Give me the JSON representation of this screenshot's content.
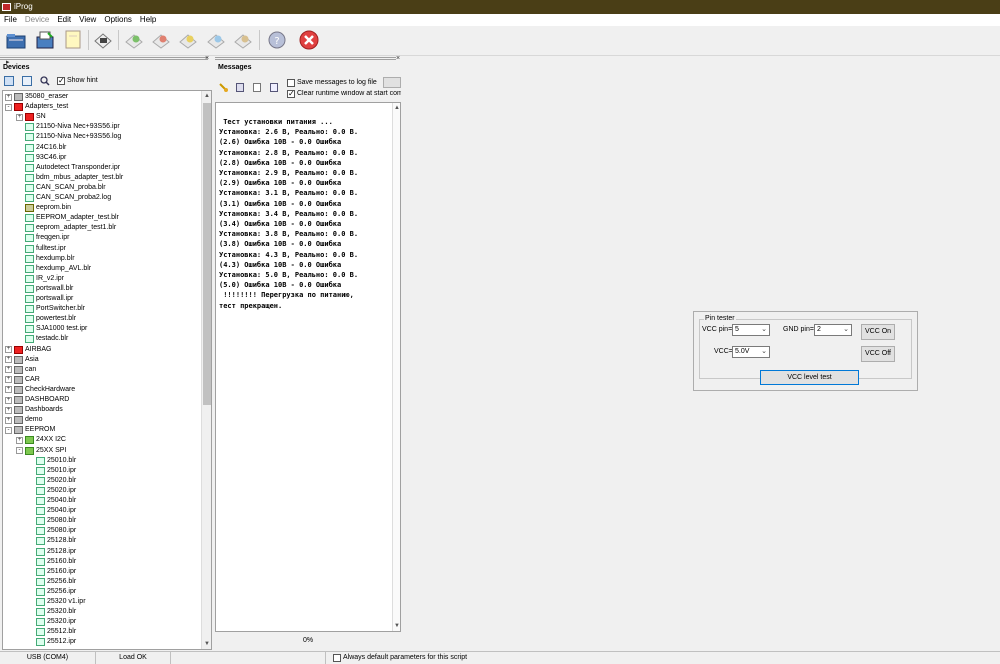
{
  "app": {
    "title": "iProg"
  },
  "menu": [
    {
      "label": "File",
      "disabled": false
    },
    {
      "label": "Device",
      "disabled": true
    },
    {
      "label": "Edit",
      "disabled": false
    },
    {
      "label": "View",
      "disabled": false
    },
    {
      "label": "Options",
      "disabled": false
    },
    {
      "label": "Help",
      "disabled": false
    }
  ],
  "devices": {
    "title": "Devices",
    "show_hint_label": "Show hint",
    "show_hint_checked": true,
    "tree": [
      {
        "label": "35080_eraser",
        "type": "tool",
        "level": 0,
        "expander": "+"
      },
      {
        "label": "Adapters_test",
        "type": "folder-red",
        "level": 0,
        "expander": "-"
      },
      {
        "label": "SN",
        "type": "folder-red",
        "level": 1,
        "expander": "+"
      },
      {
        "label": "21150-Niva Nec+93S56.ipr",
        "type": "file",
        "level": 1
      },
      {
        "label": "21150-Niva Nec+93S56.log",
        "type": "file",
        "level": 1
      },
      {
        "label": "24C16.blr",
        "type": "file",
        "level": 1
      },
      {
        "label": "93C46.ipr",
        "type": "file",
        "level": 1
      },
      {
        "label": "Autodetect Transponder.ipr",
        "type": "file",
        "level": 1
      },
      {
        "label": "bdm_mbus_adapter_test.blr",
        "type": "file",
        "level": 1
      },
      {
        "label": "CAN_SCAN_proba.blr",
        "type": "file",
        "level": 1
      },
      {
        "label": "CAN_SCAN_proba2.log",
        "type": "file",
        "level": 1
      },
      {
        "label": "eeprom.bin",
        "type": "bin",
        "level": 1
      },
      {
        "label": "EEPROM_adapter_test.blr",
        "type": "file",
        "level": 1
      },
      {
        "label": "eeprom_adapter_test1.blr",
        "type": "file",
        "level": 1
      },
      {
        "label": "freqgen.ipr",
        "type": "file",
        "level": 1
      },
      {
        "label": "fulltest.ipr",
        "type": "file",
        "level": 1
      },
      {
        "label": "hexdump.blr",
        "type": "file",
        "level": 1
      },
      {
        "label": "hexdump_AVL.blr",
        "type": "file",
        "level": 1
      },
      {
        "label": "IR_v2.ipr",
        "type": "file",
        "level": 1
      },
      {
        "label": "portswall.blr",
        "type": "file",
        "level": 1
      },
      {
        "label": "portswall.ipr",
        "type": "file",
        "level": 1
      },
      {
        "label": "PortSwitcher.blr",
        "type": "file",
        "level": 1
      },
      {
        "label": "powertest.blr",
        "type": "file",
        "level": 1
      },
      {
        "label": "SJA1000 test.ipr",
        "type": "file",
        "level": 1
      },
      {
        "label": "testadc.blr",
        "type": "file",
        "level": 1
      },
      {
        "label": "AIRBAG",
        "type": "red",
        "level": 0,
        "expander": "+"
      },
      {
        "label": "Asia",
        "type": "gray",
        "level": 0,
        "expander": "+"
      },
      {
        "label": "can",
        "type": "gray",
        "level": 0,
        "expander": "+"
      },
      {
        "label": "CAR",
        "type": "gray",
        "level": 0,
        "expander": "+"
      },
      {
        "label": "CheckHardware",
        "type": "gray",
        "level": 0,
        "expander": "+"
      },
      {
        "label": "DASHBOARD",
        "type": "gray",
        "level": 0,
        "expander": "+"
      },
      {
        "label": "Dashboards",
        "type": "gray",
        "level": 0,
        "expander": "+"
      },
      {
        "label": "demo",
        "type": "gray",
        "level": 0,
        "expander": "+"
      },
      {
        "label": "EEPROM",
        "type": "gray",
        "level": 0,
        "expander": "-"
      },
      {
        "label": "24XX I2C",
        "type": "folder",
        "level": 1,
        "expander": "+"
      },
      {
        "label": "25XX SPI",
        "type": "folder",
        "level": 1,
        "expander": "-"
      },
      {
        "label": "25010.blr",
        "type": "file",
        "level": 2
      },
      {
        "label": "25010.ipr",
        "type": "file",
        "level": 2
      },
      {
        "label": "25020.blr",
        "type": "file",
        "level": 2
      },
      {
        "label": "25020.ipr",
        "type": "file",
        "level": 2
      },
      {
        "label": "25040.blr",
        "type": "file",
        "level": 2
      },
      {
        "label": "25040.ipr",
        "type": "file",
        "level": 2
      },
      {
        "label": "25080.blr",
        "type": "file",
        "level": 2
      },
      {
        "label": "25080.ipr",
        "type": "file",
        "level": 2
      },
      {
        "label": "25128.blr",
        "type": "file",
        "level": 2
      },
      {
        "label": "25128.ipr",
        "type": "file",
        "level": 2
      },
      {
        "label": "25160.blr",
        "type": "file",
        "level": 2
      },
      {
        "label": "25160.ipr",
        "type": "file",
        "level": 2
      },
      {
        "label": "25256.blr",
        "type": "file",
        "level": 2
      },
      {
        "label": "25256.ipr",
        "type": "file",
        "level": 2
      },
      {
        "label": "25320 v1.ipr",
        "type": "file",
        "level": 2
      },
      {
        "label": "25320.blr",
        "type": "file",
        "level": 2
      },
      {
        "label": "25320.ipr",
        "type": "file",
        "level": 2
      },
      {
        "label": "25512.blr",
        "type": "file",
        "level": 2
      },
      {
        "label": "25512.ipr",
        "type": "file",
        "level": 2
      }
    ]
  },
  "messages": {
    "title": "Messages",
    "save_to_log_label": "Save messages to log file",
    "save_to_log_checked": false,
    "clear_runtime_label": "Clear runtime window at start comm",
    "clear_runtime_checked": true,
    "lines": [
      " Тест установки питания ...",
      "Установка: 2.6 В, Реально: 0.0 В.",
      "(2.6) Ошибка 10В - 0.0 Ошибка",
      "Установка: 2.8 В, Реально: 0.0 В.",
      "(2.8) Ошибка 10В - 0.0 Ошибка",
      "Установка: 2.9 В, Реально: 0.0 В.",
      "(2.9) Ошибка 10В - 0.0 Ошибка",
      "Установка: 3.1 В, Реально: 0.0 В.",
      "(3.1) Ошибка 10В - 0.0 Ошибка",
      "Установка: 3.4 В, Реально: 0.0 В.",
      "(3.4) Ошибка 10В - 0.0 Ошибка",
      "Установка: 3.8 В, Реально: 0.0 В.",
      "(3.8) Ошибка 10В - 0.0 Ошибка",
      "Установка: 4.3 В, Реально: 0.0 В.",
      "(4.3) Ошибка 10В - 0.0 Ошибка",
      "Установка: 5.0 В, Реально: 0.0 В.",
      "(5.0) Ошибка 10В - 0.0 Ошибка",
      " !!!!!!!! Перегрузка по питанию,",
      "тест прекращен."
    ],
    "progress": "0%"
  },
  "pin_tester": {
    "legend": "Pin tester",
    "vcc_pin_label": "VCC pin=",
    "vcc_pin_value": "5",
    "gnd_pin_label": "GND pin=",
    "gnd_pin_value": "2",
    "vcc_label": "VCC=",
    "vcc_value": "5.0V",
    "vcc_on_label": "VCC On",
    "vcc_off_label": "VCC Off",
    "level_test_label": "VCC level test"
  },
  "status": {
    "port": "USB (COM4)",
    "state": "Load OK",
    "always_default_label": "Always default parameters for this script",
    "always_default_checked": false
  },
  "icons": [
    "open-folder-icon",
    "save-icon",
    "new-file-icon",
    "chip-icon",
    "read-icon",
    "write-icon",
    "verify-icon",
    "erase-icon",
    "program-icon",
    "help-icon",
    "stop-icon"
  ]
}
